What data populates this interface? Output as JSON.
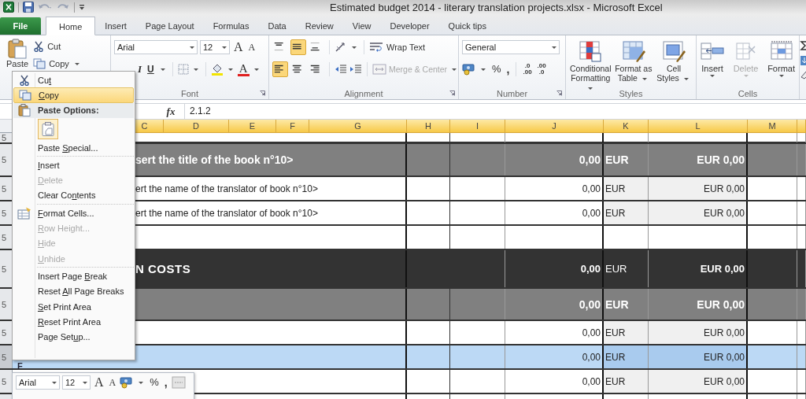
{
  "title_bar": {
    "title": "Estimated budget 2014 - literary translation projects.xlsx - Microsoft Excel"
  },
  "tabs": [
    {
      "label": "File",
      "kind": "file",
      "selected": false
    },
    {
      "label": "Home",
      "kind": "tab",
      "selected": true
    },
    {
      "label": "Insert",
      "kind": "tab",
      "selected": false
    },
    {
      "label": "Page Layout",
      "kind": "tab",
      "selected": false
    },
    {
      "label": "Formulas",
      "kind": "tab",
      "selected": false
    },
    {
      "label": "Data",
      "kind": "tab",
      "selected": false
    },
    {
      "label": "Review",
      "kind": "tab",
      "selected": false
    },
    {
      "label": "View",
      "kind": "tab",
      "selected": false
    },
    {
      "label": "Developer",
      "kind": "tab",
      "selected": false
    },
    {
      "label": "Quick tips",
      "kind": "tab",
      "selected": false
    }
  ],
  "ribbon": {
    "clipboard": {
      "paste": "Paste",
      "cut": "Cut",
      "copy": "Copy"
    },
    "font": {
      "label": "Font",
      "font_name": "Arial",
      "font_size": "12",
      "grow": "A",
      "shrink": "A",
      "italic": "I",
      "underline": "U",
      "font_color": "A"
    },
    "alignment": {
      "label": "Alignment",
      "wrap_text": "Wrap Text",
      "merge_center": "Merge & Center",
      "merge_disabled": true,
      "vertical": [
        {
          "selected": false
        },
        {
          "selected": true
        },
        {
          "selected": false
        }
      ],
      "horizontal": [
        {
          "selected": true
        },
        {
          "selected": false
        },
        {
          "selected": false
        }
      ]
    },
    "number": {
      "label": "Number",
      "format": "General",
      "percent": "%",
      "comma": ",",
      "increase_decimal": [
        ".0",
        ".00"
      ],
      "decrease_decimal": [
        ".00",
        ".0"
      ]
    },
    "styles": {
      "label": "Styles",
      "buttons": [
        {
          "label": "Conditional Formatting"
        },
        {
          "label": "Format as Table"
        },
        {
          "label": "Cell Styles"
        }
      ]
    },
    "cells": {
      "label": "Cells",
      "buttons": [
        {
          "label": "Insert",
          "disabled": false
        },
        {
          "label": "Delete",
          "disabled": true
        },
        {
          "label": "Format",
          "disabled": false
        }
      ]
    }
  },
  "formula_bar": {
    "function_button": "fx",
    "value": "2.1.2"
  },
  "sheet": {
    "columns": [
      "C",
      "D",
      "E",
      "F",
      "G",
      "H",
      "I",
      "J",
      "K",
      "L",
      "M"
    ],
    "column_marker": "F",
    "rows": [
      {
        "kind": "spacer",
        "row_header": "5",
        "selected": false
      },
      {
        "kind": "title",
        "row_header": "5",
        "text": "sert the title of the book n°10>",
        "amount": "0,00",
        "currency": "EUR",
        "total": "EUR 0,00",
        "selected": false
      },
      {
        "kind": "item",
        "row_header": "5",
        "text": "ert the name of the translator of book n°10>",
        "amount": "0,00",
        "currency": "EUR",
        "total": "EUR 0,00",
        "selected": false
      },
      {
        "kind": "item",
        "row_header": "5",
        "text": "ert the name of the translator of book n°10>",
        "amount": "0,00",
        "currency": "EUR",
        "total": "EUR 0,00",
        "selected": false
      },
      {
        "kind": "blank",
        "row_header": "5",
        "selected": false
      },
      {
        "kind": "section",
        "row_header": "5",
        "text": "N COSTS",
        "amount": "0,00",
        "currency": "EUR",
        "total": "EUR 0,00",
        "selected": false
      },
      {
        "kind": "subtotal",
        "row_header": "5",
        "amount": "0,00",
        "currency": "EUR",
        "total": "EUR 0,00",
        "selected": false
      },
      {
        "kind": "item",
        "row_header": "5",
        "amount": "0,00",
        "currency": "EUR",
        "total": "EUR 0,00",
        "selected": false
      },
      {
        "kind": "item",
        "row_header": "5",
        "amount": "0,00",
        "currency": "EUR",
        "total": "EUR 0,00",
        "selected": true
      },
      {
        "kind": "item",
        "row_header": "5",
        "amount": "0,00",
        "currency": "EUR",
        "total": "EUR 0,00",
        "selected": false
      },
      {
        "kind": "blank",
        "selected": false
      }
    ]
  },
  "context_menu": {
    "items": [
      {
        "kind": "command",
        "label": {
          "before": "Cu",
          "key": "t"
        },
        "selected": false,
        "disabled": false
      },
      {
        "kind": "command",
        "label": {
          "key": "C",
          "after": "opy"
        },
        "selected": true,
        "disabled": false
      },
      {
        "kind": "heading",
        "label": "Paste Options:"
      },
      {
        "kind": "paste-options"
      },
      {
        "kind": "command",
        "label": {
          "before": "Paste ",
          "key": "S",
          "after": "pecial..."
        },
        "selected": false,
        "disabled": false
      },
      {
        "kind": "separator"
      },
      {
        "kind": "command",
        "label": {
          "key": "I",
          "after": "nsert"
        },
        "selected": false,
        "disabled": false
      },
      {
        "kind": "command",
        "label": {
          "key": "D",
          "after": "elete"
        },
        "selected": false,
        "disabled": true
      },
      {
        "kind": "command",
        "label": {
          "before": "Clear Co",
          "key": "n",
          "after": "tents"
        },
        "selected": false,
        "disabled": false
      },
      {
        "kind": "separator"
      },
      {
        "kind": "command",
        "label": {
          "key": "F",
          "after": "ormat Cells..."
        },
        "selected": false,
        "disabled": false
      },
      {
        "kind": "command",
        "label": {
          "key": "R",
          "after": "ow Height..."
        },
        "selected": false,
        "disabled": true
      },
      {
        "kind": "command",
        "label": {
          "key": "H",
          "after": "ide"
        },
        "selected": false,
        "disabled": true
      },
      {
        "kind": "command",
        "label": {
          "key": "U",
          "after": "nhide"
        },
        "selected": false,
        "disabled": true
      },
      {
        "kind": "separator"
      },
      {
        "kind": "command",
        "label": {
          "before": "Insert Page ",
          "key": "B",
          "after": "reak"
        },
        "selected": false,
        "disabled": false
      },
      {
        "kind": "command",
        "label": {
          "before": "Reset ",
          "key": "A",
          "after": "ll Page Breaks"
        },
        "selected": false,
        "disabled": false
      },
      {
        "kind": "command",
        "label": {
          "key": "S",
          "after": "et Print Area"
        },
        "selected": false,
        "disabled": false
      },
      {
        "kind": "command",
        "label": {
          "key": "R",
          "after": "eset Print Area"
        },
        "selected": false,
        "disabled": false
      },
      {
        "kind": "command",
        "label": {
          "before": "Page Set",
          "key": "u",
          "after": "p..."
        },
        "selected": false,
        "disabled": false
      }
    ]
  },
  "mini_toolbar": {
    "font_name": "Arial",
    "font_size": "12",
    "grow": "A",
    "shrink": "A",
    "percent": "%",
    "comma": ","
  }
}
